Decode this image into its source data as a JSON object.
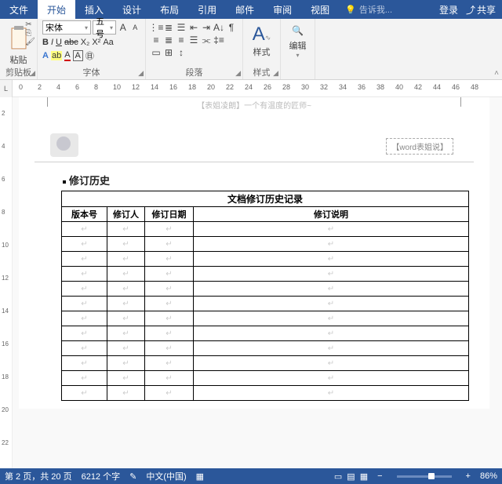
{
  "tabs": {
    "file": "文件",
    "home": "开始",
    "insert": "插入",
    "design": "设计",
    "layout": "布局",
    "references": "引用",
    "mail": "邮件",
    "review": "审阅",
    "view": "视图"
  },
  "tellme": "告诉我...",
  "login": "登录",
  "share": "共享",
  "ribbon": {
    "clipboard": {
      "label": "剪贴板",
      "paste": "粘贴"
    },
    "font": {
      "label": "字体",
      "name": "宋体",
      "size": "五号",
      "grow": "A",
      "shrink": "A",
      "clear": "Aa",
      "bold": "B",
      "italic": "I",
      "underline": "U",
      "strike": "abc",
      "sub": "X₂",
      "sup": "X²",
      "effect": "A",
      "highlight": "ab",
      "color": "A"
    },
    "para": {
      "label": "段落"
    },
    "styles": {
      "label": "样式",
      "btn": "样式"
    },
    "editing": {
      "label": "",
      "btn": "编辑"
    }
  },
  "ruler": {
    "marks": [
      "0",
      "2",
      "4",
      "6",
      "8",
      "10",
      "12",
      "14",
      "16",
      "18",
      "20",
      "22",
      "24",
      "26",
      "28",
      "30",
      "32",
      "34",
      "36",
      "38",
      "40",
      "42",
      "44",
      "46",
      "48"
    ]
  },
  "vruler": [
    "2",
    "4",
    "6",
    "8",
    "10",
    "12",
    "14",
    "16",
    "18",
    "20",
    "22"
  ],
  "doc": {
    "topnote": "【表姐凌朗】一个有温度的匠师~",
    "inserted_box": "【word表姐说】",
    "heading": "修订历史",
    "table": {
      "title": "文档修订历史记录",
      "cols": [
        "版本号",
        "修订人",
        "修订日期",
        "修订说明"
      ],
      "rows": 12
    }
  },
  "status": {
    "page": "第 2 页，共 20 页",
    "words": "6212 个字",
    "lang": "中文(中国)",
    "zoom": "86%"
  }
}
